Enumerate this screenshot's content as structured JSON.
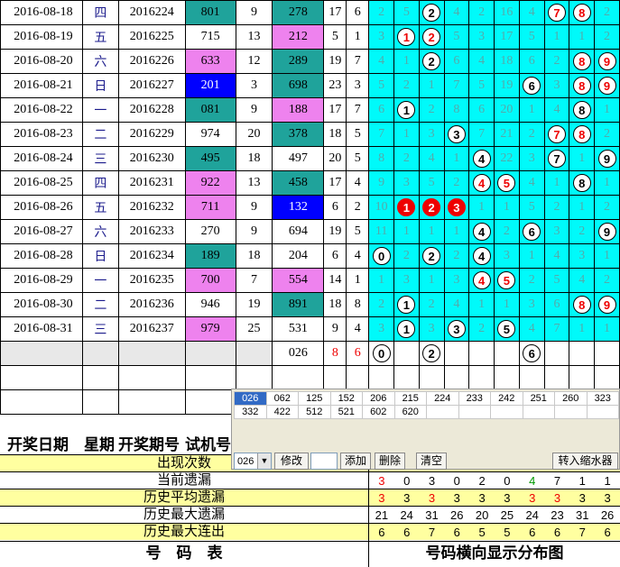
{
  "rows": [
    {
      "date": "2016-08-18",
      "wk": "四",
      "issue": "2016224",
      "a": "801",
      "ac": "teal",
      "b": "9",
      "c": "278",
      "cc": "teal",
      "d": "17",
      "e": "6",
      "dist": [
        {
          "v": "2"
        },
        {
          "v": "5"
        },
        {
          "v": "2",
          "b": "w"
        },
        {
          "v": "4"
        },
        {
          "v": "2"
        },
        {
          "v": "16"
        },
        {
          "v": "4"
        },
        {
          "v": "7",
          "b": "r"
        },
        {
          "v": "8",
          "b": "r"
        },
        {
          "v": "2"
        }
      ]
    },
    {
      "date": "2016-08-19",
      "wk": "五",
      "issue": "2016225",
      "a": "715",
      "ac": "",
      "b": "13",
      "c": "212",
      "cc": "pink",
      "d": "5",
      "e": "1",
      "dist": [
        {
          "v": "3"
        },
        {
          "v": "1",
          "b": "r"
        },
        {
          "v": "2",
          "b": "r"
        },
        {
          "v": "5"
        },
        {
          "v": "3"
        },
        {
          "v": "17"
        },
        {
          "v": "5"
        },
        {
          "v": "1"
        },
        {
          "v": "1"
        },
        {
          "v": "2"
        }
      ]
    },
    {
      "date": "2016-08-20",
      "wk": "六",
      "issue": "2016226",
      "a": "633",
      "ac": "pink",
      "b": "12",
      "c": "289",
      "cc": "teal",
      "d": "19",
      "e": "7",
      "dist": [
        {
          "v": "4"
        },
        {
          "v": "1"
        },
        {
          "v": "2",
          "b": "w"
        },
        {
          "v": "6"
        },
        {
          "v": "4"
        },
        {
          "v": "18"
        },
        {
          "v": "6"
        },
        {
          "v": "2"
        },
        {
          "v": "8",
          "b": "r"
        },
        {
          "v": "9",
          "b": "r"
        }
      ]
    },
    {
      "date": "2016-08-21",
      "wk": "日",
      "issue": "2016227",
      "a": "201",
      "ac": "blue",
      "b": "3",
      "c": "698",
      "cc": "teal",
      "d": "23",
      "e": "3",
      "dist": [
        {
          "v": "5"
        },
        {
          "v": "2"
        },
        {
          "v": "1"
        },
        {
          "v": "7"
        },
        {
          "v": "5"
        },
        {
          "v": "19"
        },
        {
          "v": "6",
          "b": "w"
        },
        {
          "v": "3"
        },
        {
          "v": "8",
          "b": "r"
        },
        {
          "v": "9",
          "b": "r"
        }
      ]
    },
    {
      "date": "2016-08-22",
      "wk": "一",
      "issue": "2016228",
      "a": "081",
      "ac": "teal",
      "b": "9",
      "c": "188",
      "cc": "pink",
      "d": "17",
      "e": "7",
      "dist": [
        {
          "v": "6"
        },
        {
          "v": "1",
          "b": "w"
        },
        {
          "v": "2"
        },
        {
          "v": "8"
        },
        {
          "v": "6"
        },
        {
          "v": "20"
        },
        {
          "v": "1"
        },
        {
          "v": "4"
        },
        {
          "v": "8",
          "b": "w"
        },
        {
          "v": "1"
        }
      ]
    },
    {
      "date": "2016-08-23",
      "wk": "二",
      "issue": "2016229",
      "a": "974",
      "ac": "",
      "b": "20",
      "c": "378",
      "cc": "teal",
      "d": "18",
      "e": "5",
      "dist": [
        {
          "v": "7"
        },
        {
          "v": "1"
        },
        {
          "v": "3"
        },
        {
          "v": "3",
          "b": "w"
        },
        {
          "v": "7"
        },
        {
          "v": "21"
        },
        {
          "v": "2"
        },
        {
          "v": "7",
          "b": "r"
        },
        {
          "v": "8",
          "b": "r"
        },
        {
          "v": "2"
        }
      ]
    },
    {
      "date": "2016-08-24",
      "wk": "三",
      "issue": "2016230",
      "a": "495",
      "ac": "teal",
      "b": "18",
      "c": "497",
      "cc": "",
      "d": "20",
      "e": "5",
      "dist": [
        {
          "v": "8"
        },
        {
          "v": "2"
        },
        {
          "v": "4"
        },
        {
          "v": "1"
        },
        {
          "v": "4",
          "b": "w"
        },
        {
          "v": "22"
        },
        {
          "v": "3"
        },
        {
          "v": "7",
          "b": "w"
        },
        {
          "v": "1"
        },
        {
          "v": "9",
          "b": "w"
        }
      ]
    },
    {
      "date": "2016-08-25",
      "wk": "四",
      "issue": "2016231",
      "a": "922",
      "ac": "pink",
      "b": "13",
      "c": "458",
      "cc": "teal",
      "d": "17",
      "e": "4",
      "dist": [
        {
          "v": "9"
        },
        {
          "v": "3"
        },
        {
          "v": "5"
        },
        {
          "v": "2"
        },
        {
          "v": "4",
          "b": "r"
        },
        {
          "v": "5",
          "b": "r"
        },
        {
          "v": "4"
        },
        {
          "v": "1"
        },
        {
          "v": "8",
          "b": "w"
        },
        {
          "v": "1"
        }
      ]
    },
    {
      "date": "2016-08-26",
      "wk": "五",
      "issue": "2016232",
      "a": "711",
      "ac": "pink",
      "b": "9",
      "c": "132",
      "cc": "blue",
      "d": "6",
      "e": "2",
      "dist": [
        {
          "v": "10"
        },
        {
          "v": "1",
          "b": "f"
        },
        {
          "v": "2",
          "b": "f"
        },
        {
          "v": "3",
          "b": "f"
        },
        {
          "v": "1"
        },
        {
          "v": "1"
        },
        {
          "v": "5"
        },
        {
          "v": "2"
        },
        {
          "v": "1"
        },
        {
          "v": "2"
        }
      ]
    },
    {
      "date": "2016-08-27",
      "wk": "六",
      "issue": "2016233",
      "a": "270",
      "ac": "",
      "b": "9",
      "c": "694",
      "cc": "",
      "d": "19",
      "e": "5",
      "dist": [
        {
          "v": "11"
        },
        {
          "v": "1"
        },
        {
          "v": "1"
        },
        {
          "v": "1"
        },
        {
          "v": "4",
          "b": "w"
        },
        {
          "v": "2"
        },
        {
          "v": "6",
          "b": "w"
        },
        {
          "v": "3"
        },
        {
          "v": "2"
        },
        {
          "v": "9",
          "b": "w"
        }
      ]
    },
    {
      "date": "2016-08-28",
      "wk": "日",
      "issue": "2016234",
      "a": "189",
      "ac": "teal",
      "b": "18",
      "c": "204",
      "cc": "",
      "d": "6",
      "e": "4",
      "dist": [
        {
          "v": "0",
          "b": "w"
        },
        {
          "v": "2"
        },
        {
          "v": "2",
          "b": "w"
        },
        {
          "v": "2"
        },
        {
          "v": "4",
          "b": "w"
        },
        {
          "v": "3"
        },
        {
          "v": "1"
        },
        {
          "v": "4"
        },
        {
          "v": "3"
        },
        {
          "v": "1"
        }
      ]
    },
    {
      "date": "2016-08-29",
      "wk": "一",
      "issue": "2016235",
      "a": "700",
      "ac": "pink",
      "b": "7",
      "c": "554",
      "cc": "pink",
      "d": "14",
      "e": "1",
      "dist": [
        {
          "v": "1"
        },
        {
          "v": "3"
        },
        {
          "v": "1"
        },
        {
          "v": "3"
        },
        {
          "v": "4",
          "b": "r"
        },
        {
          "v": "5",
          "b": "r"
        },
        {
          "v": "2"
        },
        {
          "v": "5"
        },
        {
          "v": "4"
        },
        {
          "v": "2"
        }
      ]
    },
    {
      "date": "2016-08-30",
      "wk": "二",
      "issue": "2016236",
      "a": "946",
      "ac": "",
      "b": "19",
      "c": "891",
      "cc": "teal",
      "d": "18",
      "e": "8",
      "dist": [
        {
          "v": "2"
        },
        {
          "v": "1",
          "b": "w"
        },
        {
          "v": "2"
        },
        {
          "v": "4"
        },
        {
          "v": "1"
        },
        {
          "v": "1"
        },
        {
          "v": "3"
        },
        {
          "v": "6"
        },
        {
          "v": "8",
          "b": "r"
        },
        {
          "v": "9",
          "b": "r"
        }
      ]
    },
    {
      "date": "2016-08-31",
      "wk": "三",
      "issue": "2016237",
      "a": "979",
      "ac": "pink",
      "b": "25",
      "c": "531",
      "cc": "",
      "d": "9",
      "e": "4",
      "dist": [
        {
          "v": "3"
        },
        {
          "v": "1",
          "b": "w"
        },
        {
          "v": "3"
        },
        {
          "v": "3",
          "b": "w"
        },
        {
          "v": "2"
        },
        {
          "v": "5",
          "b": "w"
        },
        {
          "v": "4"
        },
        {
          "v": "7"
        },
        {
          "v": "1"
        },
        {
          "v": "1"
        }
      ]
    }
  ],
  "current": {
    "c": "026",
    "d": "8",
    "e": "6",
    "balls": [
      "0",
      "",
      "2",
      "",
      "",
      "",
      "6",
      "",
      "",
      ""
    ]
  },
  "header": {
    "date": "开奖日期",
    "wk": "星期",
    "issue": "开奖期号",
    "test": "试机号"
  },
  "stats": [
    {
      "label": "出现次数",
      "values": []
    },
    {
      "label": "当前遗漏",
      "values": [
        "3",
        "0",
        "3",
        "0",
        "2",
        "0",
        "4",
        "7",
        "1",
        "1"
      ],
      "colors": [
        "#e00",
        "",
        "",
        "",
        "",
        "",
        "#090",
        "",
        "",
        ""
      ]
    },
    {
      "label": "历史平均遗漏",
      "values": [
        "3",
        "3",
        "3",
        "3",
        "3",
        "3",
        "3",
        "3",
        "3",
        "3"
      ],
      "colors": [
        "#e00",
        "",
        "#e00",
        "",
        "",
        "",
        "#e00",
        "#e00",
        "",
        ""
      ]
    },
    {
      "label": "历史最大遗漏",
      "values": [
        "21",
        "24",
        "31",
        "26",
        "20",
        "25",
        "24",
        "23",
        "31",
        "26"
      ]
    },
    {
      "label": "历史最大连出",
      "values": [
        "6",
        "6",
        "7",
        "6",
        "5",
        "5",
        "6",
        "6",
        "7",
        "6"
      ]
    }
  ],
  "panel": {
    "numbers": [
      "026",
      "062",
      "125",
      "152",
      "206",
      "215",
      "224",
      "233",
      "242",
      "251",
      "260",
      "323",
      "332",
      "422",
      "512",
      "521",
      "602",
      "620"
    ],
    "selected": "026",
    "combo": "026",
    "buttons": {
      "modify": "修改",
      "add": "添加",
      "delete": "删除",
      "clear": "清空",
      "transfer": "转入缩水器"
    }
  },
  "footer": {
    "left": "号　码　表",
    "right": "号码横向显示分布图"
  },
  "colors": {
    "teal": "#1fa39b",
    "pink": "#ee82ee",
    "blue": "#0000ff",
    "cyan": "#00fafa",
    "yellow": "#ffffa0"
  }
}
